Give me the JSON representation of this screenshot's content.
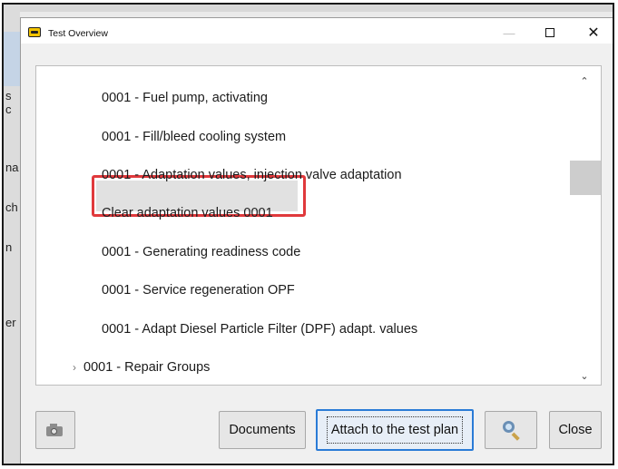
{
  "window": {
    "title": "Test Overview",
    "minimize_glyph": "—",
    "close_glyph": "✕"
  },
  "background_app": {
    "letters": [
      "s c",
      "na",
      "ch",
      "n",
      "er"
    ]
  },
  "list": {
    "items": [
      {
        "label": "0001 - Fuel pump, activating",
        "selected": false
      },
      {
        "label": "0001 - Fill/bleed cooling system",
        "selected": false
      },
      {
        "label": "0001 - Adaptation values, injection valve adaptation",
        "selected": false
      },
      {
        "label": "Clear adaptation values 0001",
        "selected": true
      },
      {
        "label": "0001 - Generating readiness code",
        "selected": false
      },
      {
        "label": "0001 - Service regeneration OPF",
        "selected": false
      },
      {
        "label": "0001 - Adapt Diesel Particle Filter (DPF) adapt. values",
        "selected": false
      }
    ],
    "group": {
      "label": "0001 - Repair Groups",
      "expanded": false
    },
    "highlight_color": "#e0393c"
  },
  "scrollbar": {
    "up_glyph": "⌃",
    "down_glyph": "⌄"
  },
  "buttons": {
    "screenshot_icon": "camera-icon",
    "documents": "Documents",
    "attach": "Attach to the test plan",
    "search_icon": "search-icon",
    "close": "Close"
  },
  "colors": {
    "accent": "#2a7bd6",
    "app_icon": "#f2c300"
  }
}
